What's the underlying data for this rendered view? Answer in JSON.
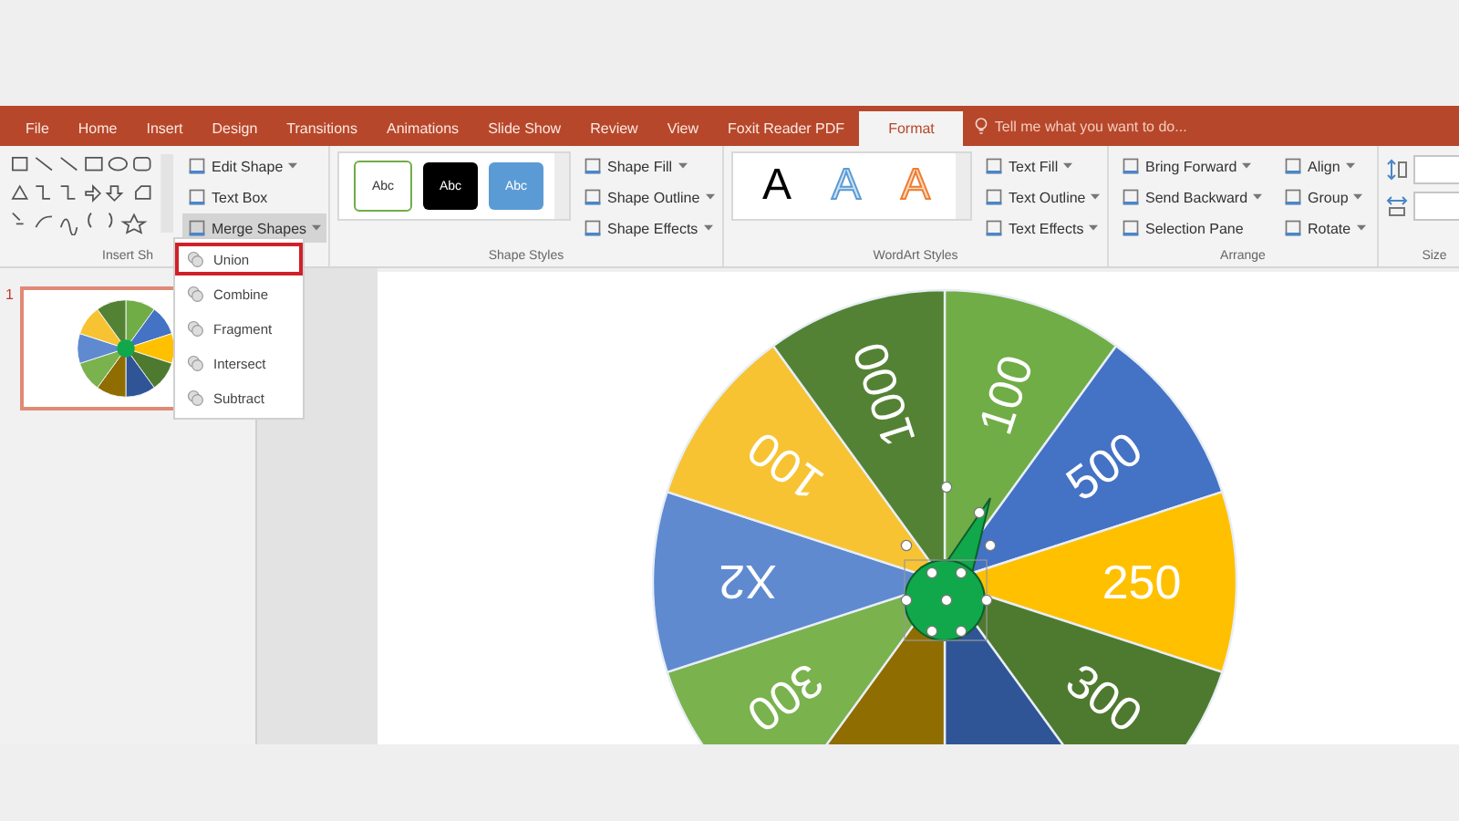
{
  "ribbon_tabs": [
    {
      "label": "File",
      "selected": false
    },
    {
      "label": "Home",
      "selected": false
    },
    {
      "label": "Insert",
      "selected": false
    },
    {
      "label": "Design",
      "selected": false
    },
    {
      "label": "Transitions",
      "selected": false
    },
    {
      "label": "Animations",
      "selected": false
    },
    {
      "label": "Slide Show",
      "selected": false
    },
    {
      "label": "Review",
      "selected": false
    },
    {
      "label": "View",
      "selected": false
    },
    {
      "label": "Foxit Reader PDF",
      "selected": false
    },
    {
      "label": "Format",
      "selected": true
    }
  ],
  "tell_me": {
    "placeholder": "Tell me what you want to do..."
  },
  "groups": [
    {
      "kind": "shapes",
      "label": "Insert Sh",
      "buttons": [
        {
          "label": "Edit Shape",
          "dropdown": true,
          "pressed": false
        },
        {
          "label": "Text Box",
          "dropdown": false,
          "pressed": false
        },
        {
          "label": "Merge Shapes",
          "dropdown": true,
          "pressed": true
        }
      ]
    },
    {
      "kind": "swatches",
      "label": "Shape Styles",
      "swatches": [
        {
          "text": "Abc",
          "kind": "outline"
        },
        {
          "text": "Abc",
          "kind": "black"
        },
        {
          "text": "Abc",
          "kind": "blue"
        }
      ],
      "buttons": [
        {
          "label": "Shape Fill",
          "dropdown": true,
          "pressed": false
        },
        {
          "label": "Shape Outline",
          "dropdown": true,
          "pressed": false
        },
        {
          "label": "Shape Effects",
          "dropdown": true,
          "pressed": false
        }
      ]
    },
    {
      "kind": "swatches",
      "label": "WordArt Styles",
      "swatches": [
        {
          "text": "A",
          "kind": "letter-black"
        },
        {
          "text": "A",
          "kind": "letter-blue"
        },
        {
          "text": "A",
          "kind": "letter-orange"
        }
      ],
      "buttons": [
        {
          "label": "Text Fill",
          "dropdown": true,
          "pressed": false
        },
        {
          "label": "Text Outline",
          "dropdown": true,
          "pressed": false
        },
        {
          "label": "Text Effects",
          "dropdown": true,
          "pressed": false
        }
      ]
    },
    {
      "kind": "arrange",
      "label": "Arrange",
      "buttons": [
        {
          "label": "Bring Forward",
          "dropdown": true,
          "pressed": false
        },
        {
          "label": "Send Backward",
          "dropdown": true,
          "pressed": false
        },
        {
          "label": "Selection Pane",
          "dropdown": false,
          "pressed": false
        },
        {
          "label": "Align",
          "dropdown": true,
          "pressed": false
        },
        {
          "label": "Group",
          "dropdown": true,
          "pressed": false
        },
        {
          "label": "Rotate",
          "dropdown": true,
          "pressed": false
        }
      ]
    },
    {
      "kind": "size",
      "label": "Size"
    }
  ],
  "merge_menu": {
    "items": [
      {
        "label": "Union",
        "selected": true
      },
      {
        "label": "Combine",
        "selected": false
      },
      {
        "label": "Fragment",
        "selected": false
      },
      {
        "label": "Intersect",
        "selected": false
      },
      {
        "label": "Subtract",
        "selected": false
      }
    ]
  },
  "thumbnails": [
    {
      "number": "1",
      "selected": true
    }
  ],
  "wheel": {
    "slices": [
      {
        "label": "100",
        "color": "#70ad47"
      },
      {
        "label": "500",
        "color": "#4472c4"
      },
      {
        "label": "250",
        "color": "#ffc000"
      },
      {
        "label": "300",
        "color": "#4e7a2f"
      },
      {
        "color": "#2f5597"
      },
      {
        "color": "#8f6d00"
      },
      {
        "label": "300",
        "color": "#7ab24e"
      },
      {
        "label": "X2",
        "color": "#5f8ad0"
      },
      {
        "label": "100",
        "color": "#f7c332"
      },
      {
        "label": "1000",
        "color": "#548235"
      }
    ]
  }
}
